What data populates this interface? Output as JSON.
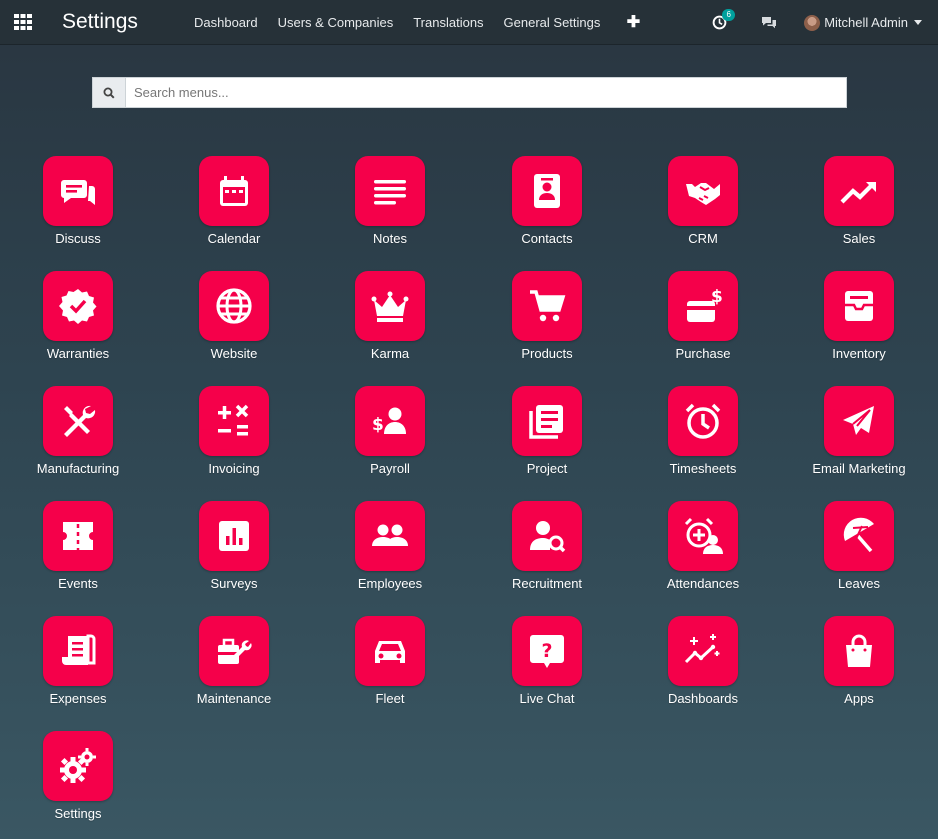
{
  "navbar": {
    "brand": "Settings",
    "menu": [
      "Dashboard",
      "Users & Companies",
      "Translations",
      "General Settings"
    ],
    "plus_symbol": "✚",
    "activity_count": "6",
    "user_name": "Mitchell Admin"
  },
  "search": {
    "placeholder": "Search menus..."
  },
  "colors": {
    "tile": "#f5004a",
    "navbar": "#263138",
    "badge": "#00a09d"
  },
  "apps": [
    {
      "label": "Discuss",
      "icon": "discuss-icon"
    },
    {
      "label": "Calendar",
      "icon": "calendar-icon"
    },
    {
      "label": "Notes",
      "icon": "notes-icon"
    },
    {
      "label": "Contacts",
      "icon": "contacts-icon"
    },
    {
      "label": "CRM",
      "icon": "handshake-icon"
    },
    {
      "label": "Sales",
      "icon": "trend-icon"
    },
    {
      "label": "Warranties",
      "icon": "badge-check-icon"
    },
    {
      "label": "Website",
      "icon": "globe-icon"
    },
    {
      "label": "Karma",
      "icon": "crown-icon"
    },
    {
      "label": "Products",
      "icon": "cart-icon"
    },
    {
      "label": "Purchase",
      "icon": "card-dollar-icon"
    },
    {
      "label": "Inventory",
      "icon": "inbox-icon"
    },
    {
      "label": "Manufacturing",
      "icon": "tools-icon"
    },
    {
      "label": "Invoicing",
      "icon": "calc-icon"
    },
    {
      "label": "Payroll",
      "icon": "payroll-icon"
    },
    {
      "label": "Project",
      "icon": "project-icon"
    },
    {
      "label": "Timesheets",
      "icon": "clock-icon"
    },
    {
      "label": "Email Marketing",
      "icon": "paper-plane-icon"
    },
    {
      "label": "Events",
      "icon": "ticket-icon"
    },
    {
      "label": "Surveys",
      "icon": "poll-icon"
    },
    {
      "label": "Employees",
      "icon": "people-icon"
    },
    {
      "label": "Recruitment",
      "icon": "user-search-icon"
    },
    {
      "label": "Attendances",
      "icon": "attendance-icon"
    },
    {
      "label": "Leaves",
      "icon": "umbrella-icon"
    },
    {
      "label": "Expenses",
      "icon": "receipt-icon"
    },
    {
      "label": "Maintenance",
      "icon": "toolbox-icon"
    },
    {
      "label": "Fleet",
      "icon": "car-icon"
    },
    {
      "label": "Live Chat",
      "icon": "question-icon"
    },
    {
      "label": "Dashboards",
      "icon": "sparkline-icon"
    },
    {
      "label": "Apps",
      "icon": "bag-icon"
    },
    {
      "label": "Settings",
      "icon": "gears-icon"
    }
  ]
}
